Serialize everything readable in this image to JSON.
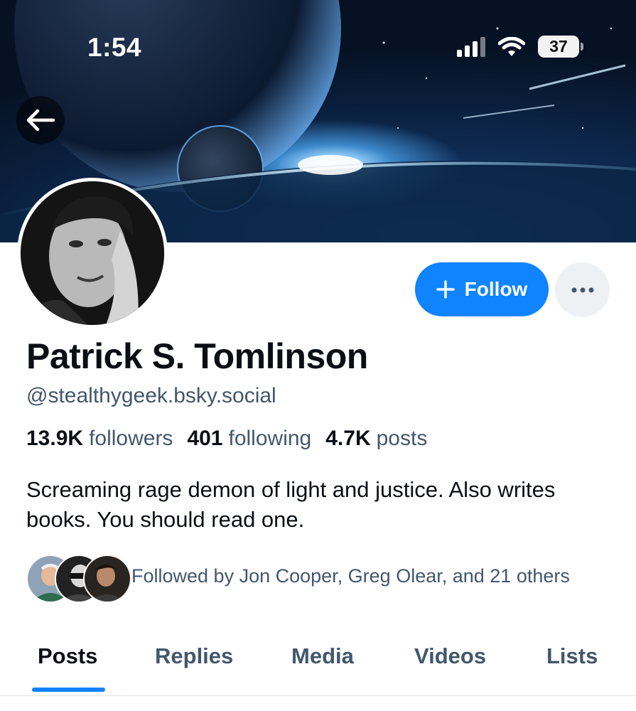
{
  "status_bar": {
    "time": "1:54",
    "battery": "37",
    "icons": [
      "signal-icon",
      "wifi-icon",
      "battery-icon"
    ]
  },
  "header": {
    "back_icon": "arrow-left-icon"
  },
  "profile": {
    "display_name": "Patrick S. Tomlinson",
    "handle": "@stealthygeek.bsky.social",
    "stats": {
      "followers_count": "13.9K",
      "followers_label": "followers",
      "following_count": "401",
      "following_label": "following",
      "posts_count": "4.7K",
      "posts_label": "posts"
    },
    "bio": "Screaming rage demon of light and justice. Also writes books. You should read one.",
    "followed_by": "Followed by Jon Cooper, Greg Olear, and 21 others"
  },
  "actions": {
    "follow_label": "Follow",
    "follow_icon": "plus-icon",
    "more_icon": "ellipsis-icon"
  },
  "tabs": [
    {
      "label": "Posts",
      "active": true
    },
    {
      "label": "Replies",
      "active": false
    },
    {
      "label": "Media",
      "active": false
    },
    {
      "label": "Videos",
      "active": false
    },
    {
      "label": "Lists",
      "active": false
    }
  ],
  "colors": {
    "accent": "#1083fe",
    "secondary_text": "#42576c",
    "primary_text": "#0b0f14"
  }
}
